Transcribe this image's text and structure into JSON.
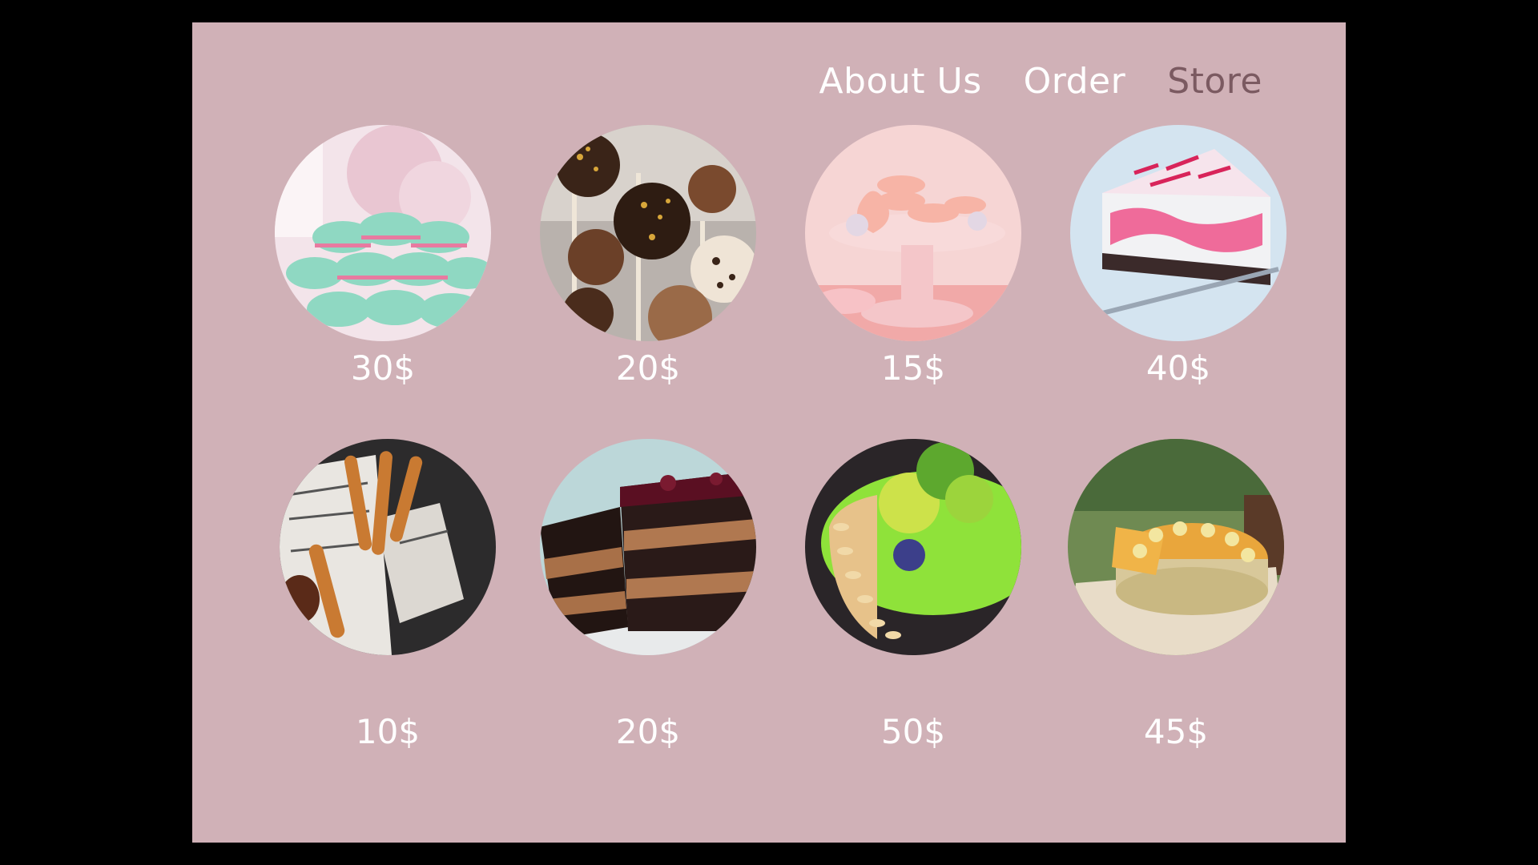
{
  "nav": {
    "about": "About Us",
    "order": "Order",
    "store": "Store"
  },
  "colors": {
    "page_background": "#000000",
    "panel_background": "#d0b1b7",
    "nav_text": "#ffffff",
    "nav_active": "#7b5a61",
    "price_text": "#ffffff"
  },
  "products": [
    {
      "name": "mint-macarons",
      "icon": "macarons-photo",
      "price": "30$"
    },
    {
      "name": "cake-pops",
      "icon": "cake-pops-photo",
      "price": "20$"
    },
    {
      "name": "pink-macaron-stand",
      "icon": "macaron-stand-photo",
      "price": "15$"
    },
    {
      "name": "raspberry-cheesecake-slice",
      "icon": "cheesecake-photo",
      "price": "40$"
    },
    {
      "name": "churros",
      "icon": "churros-photo",
      "price": "10$"
    },
    {
      "name": "chocolate-layer-cake",
      "icon": "layer-cake-photo",
      "price": "20$"
    },
    {
      "name": "green-almond-cake",
      "icon": "green-cake-photo",
      "price": "50$"
    },
    {
      "name": "citrus-crepe-cake",
      "icon": "crepe-cake-photo",
      "price": "45$"
    }
  ]
}
